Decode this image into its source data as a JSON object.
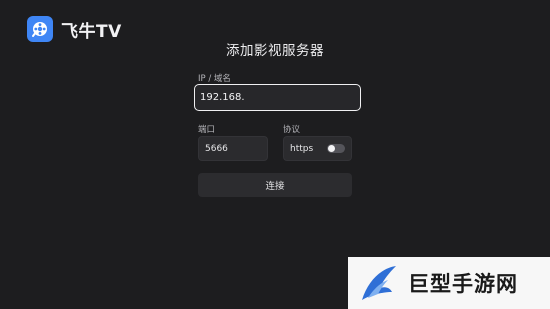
{
  "app": {
    "name": "飞牛TV"
  },
  "page": {
    "title": "添加影视服务器"
  },
  "form": {
    "host": {
      "label": "IP / 域名",
      "value": "192.168."
    },
    "port": {
      "label": "端口",
      "value": "5666"
    },
    "protocol": {
      "label": "协议",
      "value": "https",
      "enabled": false
    },
    "connect_label": "连接"
  },
  "watermark": {
    "text": "巨型手游网"
  },
  "colors": {
    "background": "#1d1d1f",
    "brand_blue": "#3f86f5",
    "field_bg": "#2b2b2e",
    "focus_border": "#f0f0f2"
  },
  "icons": {
    "app_logo": "film-reel-icon",
    "watermark_logo": "swoosh-e-logo"
  }
}
